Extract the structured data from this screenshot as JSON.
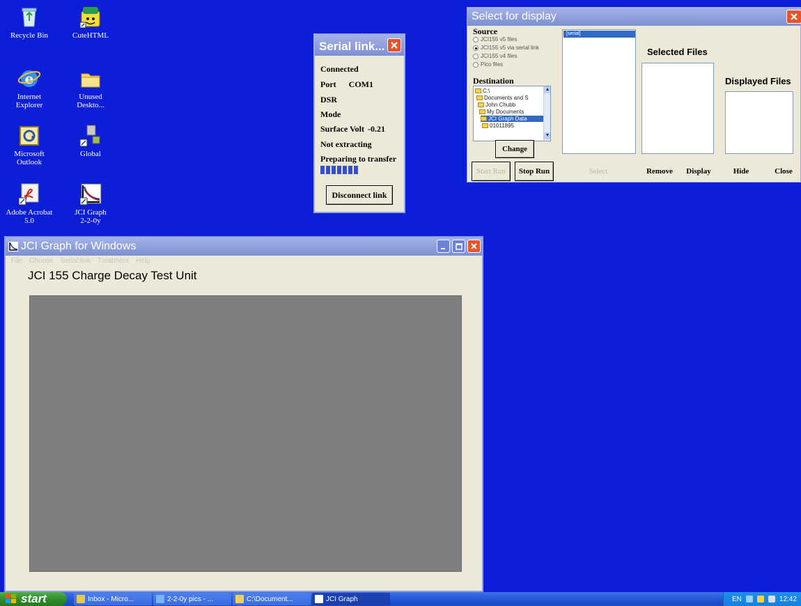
{
  "desktop": {
    "icons": [
      {
        "label": "Recycle Bin",
        "icon": "recycle-bin-icon"
      },
      {
        "label": "CuteHTML",
        "icon": "cutehtml-icon"
      },
      {
        "label": "Internet\nExplorer",
        "icon": "internet-explorer-icon"
      },
      {
        "label": "Unused\nDeskto...",
        "icon": "folder-icon"
      },
      {
        "label": "Microsoft\nOutlook",
        "icon": "outlook-icon"
      },
      {
        "label": "Global",
        "icon": "global-shortcut-icon"
      },
      {
        "label": "Adobe Acrobat\n5.0",
        "icon": "adobe-acrobat-icon"
      },
      {
        "label": "JCI Graph\n2-2-0y",
        "icon": "jci-graph-icon"
      }
    ]
  },
  "serial": {
    "title": "Serial link...",
    "status": "Connected",
    "port_label": "Port",
    "port_value": "COM1",
    "dsr_label": "DSR",
    "mode_label": "Mode",
    "surface_label": "Surface Volt",
    "surface_value": "-0.21",
    "extract_status": "Not extracting",
    "transfer_status": "Preparing to transfer",
    "progress_blocks": 7,
    "disconnect_label": "Disconnect link"
  },
  "select": {
    "title": "Select for display",
    "source_label": "Source",
    "sources": [
      {
        "label": "JCI155 v5 files",
        "checked": false
      },
      {
        "label": "JCI155 v5 via serial link",
        "checked": true
      },
      {
        "label": "JCI155 v4 files",
        "checked": false
      },
      {
        "label": "Pico files",
        "checked": false
      }
    ],
    "destination_label": "Destination",
    "tree": [
      {
        "label": "C:\\",
        "selected": false
      },
      {
        "label": "Documents and S",
        "selected": false
      },
      {
        "label": "John Chubb",
        "selected": false
      },
      {
        "label": "My Documents",
        "selected": false
      },
      {
        "label": "JCI Graph Data",
        "selected": true
      },
      {
        "label": "01011895",
        "selected": false
      }
    ],
    "change_label": "Change",
    "file_list_selected": "[serial]",
    "selected_files_header": "Selected Files",
    "displayed_files_header": "Displayed Files",
    "buttons": {
      "start_run": "Start Run",
      "stop_run": "Stop Run",
      "select": "Select",
      "remove": "Remove",
      "display": "Display",
      "hide": "Hide",
      "close": "Close"
    }
  },
  "jci": {
    "title": "JCI Graph for Windows",
    "menu": [
      "File",
      "Choose",
      "Serial link",
      "Treatment",
      "Help"
    ],
    "heading": "JCI 155 Charge Decay Test Unit"
  },
  "taskbar": {
    "start_label": "start",
    "tasks": [
      {
        "label": "Inbox - Micro...",
        "active": false,
        "color": "#e5c94a"
      },
      {
        "label": "2-2-0y pics - ...",
        "active": false,
        "color": "#7ab2f5"
      },
      {
        "label": "C:\\Document...",
        "active": false,
        "color": "#f1cf54"
      },
      {
        "label": "JCI Graph",
        "active": true,
        "color": "#ffffff"
      }
    ],
    "language": "EN",
    "clock": "12:42"
  },
  "colors": {
    "desktop": "#0d1fd6",
    "title_bar": "#8e9fdc",
    "close_button": "#e4562a",
    "progress": "#3650c8",
    "selection": "#316ac5",
    "plot_area": "#7f7f7f"
  }
}
